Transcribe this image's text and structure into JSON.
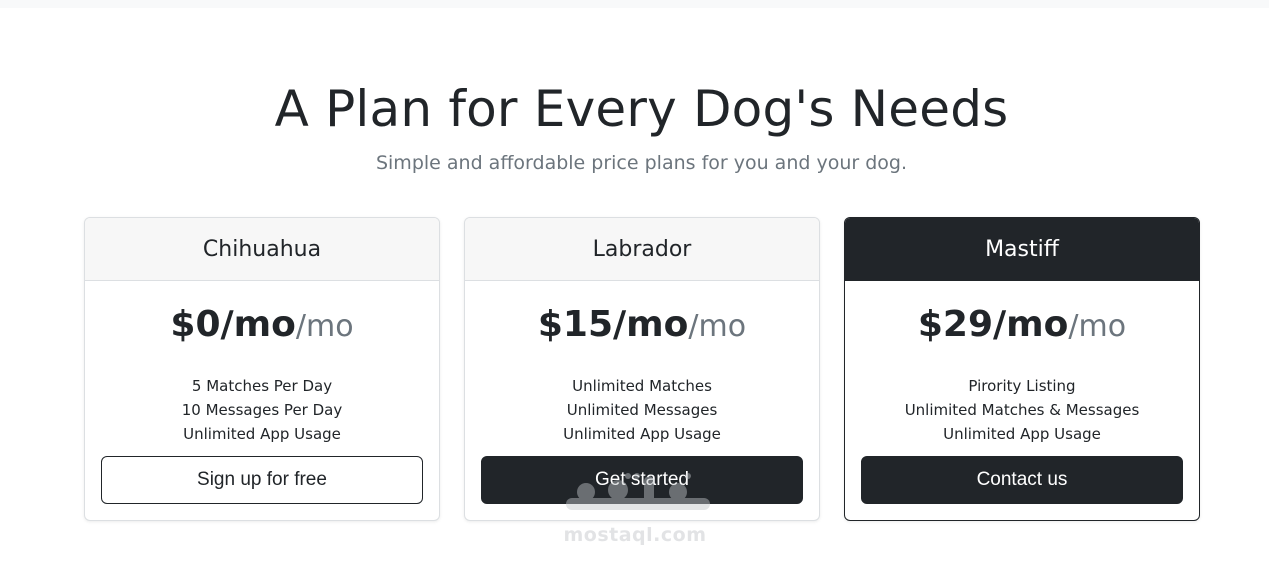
{
  "header": {
    "title": "A Plan for Every Dog's Needs",
    "subtitle": "Simple and affordable price plans for you and your dog."
  },
  "plans": [
    {
      "name": "Chihuahua",
      "price": "$0/mo",
      "unit": "/mo",
      "features": [
        "5 Matches Per Day",
        "10 Messages Per Day",
        "Unlimited App Usage"
      ],
      "button": "Sign up for free"
    },
    {
      "name": "Labrador",
      "price": "$15/mo",
      "unit": "/mo",
      "features": [
        "Unlimited Matches",
        "Unlimited Messages",
        "Unlimited App Usage"
      ],
      "button": "Get started"
    },
    {
      "name": "Mastiff",
      "price": "$29/mo",
      "unit": "/mo",
      "features": [
        "Pirority Listing",
        "Unlimited Matches & Messages",
        "Unlimited App Usage"
      ],
      "button": "Contact us"
    }
  ],
  "watermark": {
    "text": "mostaql.com"
  },
  "colors": {
    "dark": "#212529",
    "muted": "#6c757d",
    "header_bg": "#f7f7f7",
    "border": "#dcdfe2"
  }
}
